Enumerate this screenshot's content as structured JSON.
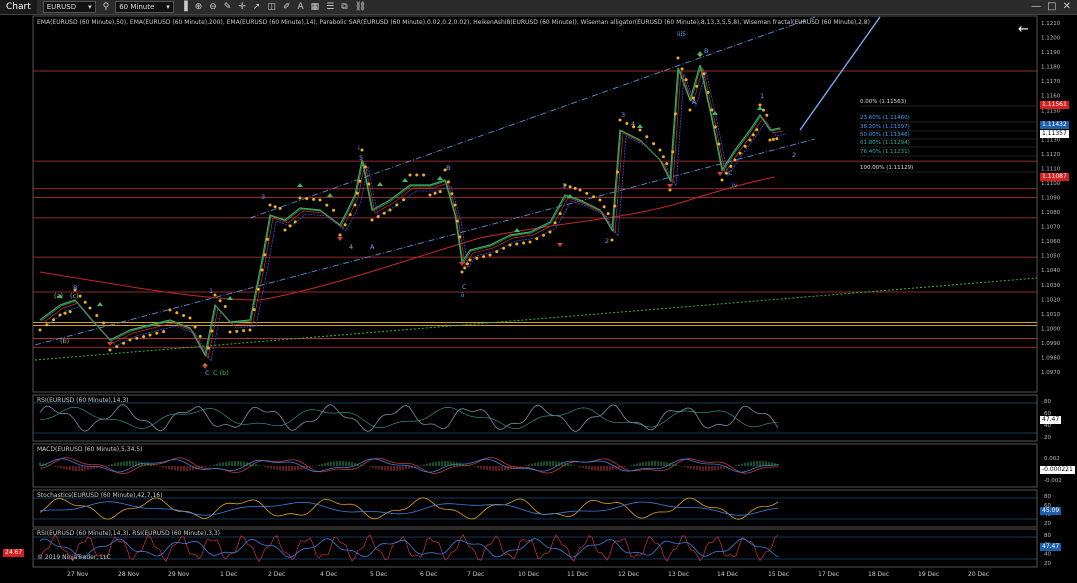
{
  "toolbar": {
    "tab_label": "Chart",
    "instrument": "EURUSD",
    "timeframe": "60 Minute",
    "icons": [
      "search-icon",
      "bar-type-icon",
      "zoom-in-icon",
      "zoom-out-icon",
      "drawing-icon",
      "crosshair-icon",
      "pointer-icon",
      "ruler-icon",
      "pencil-icon",
      "text-icon",
      "grid-icon",
      "list-icon",
      "split-icon",
      "link-icon"
    ]
  },
  "main_panel": {
    "indicators_caption": "EMA(EURUSD (60 Minute),50), EMA(EURUSD (60 Minute),200), EMA(EURUSD (60 Minute),14), Parabolic SAR(EURUSD (60 Minute),0.02,0.2,0.02), HeikenAshi8(EURUSD (60 Minute)), Wiseman alligator(EURUSD (60 Minute),8,13,3,5,5,8), Wiseman fractal(EURUSD (60 Minute),2,8)",
    "price_axis": [
      "1.1210",
      "1.1200",
      "1.1190",
      "1.1180",
      "1.1170",
      "1.1160",
      "1.1150",
      "1.1140",
      "1.1130",
      "1.1120",
      "1.1110",
      "1.1100",
      "1.1090",
      "1.1080",
      "1.1070",
      "1.1060",
      "1.1050",
      "1.1040",
      "1.1030",
      "1.1020",
      "1.1010",
      "1.1000",
      "1.0990",
      "1.0980",
      "1.0970"
    ],
    "price_badges": [
      {
        "text": "1.11561",
        "color": "#d62020"
      },
      {
        "text": "1.11432",
        "color": "#1b5fae"
      },
      {
        "text": "1.11357",
        "color": "#ffffff"
      },
      {
        "text": "1.11087",
        "color": "#d62020"
      }
    ],
    "fib_levels": [
      {
        "text": "0.00% (1.11563)",
        "color": "#dddddd"
      },
      {
        "text": "23.60% (1.11460)",
        "color": "#3aa0ff"
      },
      {
        "text": "38.20% (1.11397)",
        "color": "#3aa0ff"
      },
      {
        "text": "50.00% (1.11346)",
        "color": "#3aa0ff"
      },
      {
        "text": "61.80% (1.11294)",
        "color": "#27b5a0"
      },
      {
        "text": "76.40% (1.11231)",
        "color": "#27b5a0"
      },
      {
        "text": "100.00% (1.11129)",
        "color": "#dddddd"
      }
    ],
    "wave_labels": [
      "(a)",
      "B",
      "(c)",
      "(b)",
      "1",
      "C",
      "C (b)",
      "3",
      "i",
      "5",
      "4",
      "A",
      "B",
      "ii",
      "C",
      "1",
      "2",
      "3",
      "4",
      "iii",
      "5",
      "B",
      "A",
      "C",
      "iv",
      "1",
      "2"
    ]
  },
  "rsi_panel": {
    "caption": "RSI(EURUSD (60 Minute),14,3)",
    "axis": [
      "80",
      "60",
      "40",
      "20"
    ],
    "value": "47.47"
  },
  "macd_panel": {
    "caption": "MACD(EURUSD (60 Minute),5,34,5)",
    "axis": [
      "0.002",
      "0",
      "-0.002"
    ],
    "value": "-0.000221"
  },
  "stoch_panel": {
    "caption": "Stochastics(EURUSD (60 Minute),42,7,16)",
    "axis": [
      "80",
      "60",
      "40",
      "20"
    ],
    "value": "45.09"
  },
  "rsi2_panel": {
    "caption": "RSI(EURUSD (60 Minute),14,3), RSI(EURUSD (60 Minute),3,3)",
    "axis": [
      "80",
      "60",
      "40",
      "20"
    ],
    "value": "47.47",
    "left_badge": "24.67"
  },
  "dates": [
    "27 Nov",
    "28 Nov",
    "29 Nov",
    "1 Dec",
    "2 Dec",
    "4 Dec",
    "5 Dec",
    "6 Dec",
    "7 Dec",
    "10 Dec",
    "11 Dec",
    "12 Dec",
    "13 Dec",
    "14 Dec",
    "15 Dec",
    "17 Dec",
    "18 Dec",
    "19 Dec",
    "20 Dec"
  ],
  "copyright": "© 2019 NinjaTrader, LLC"
}
